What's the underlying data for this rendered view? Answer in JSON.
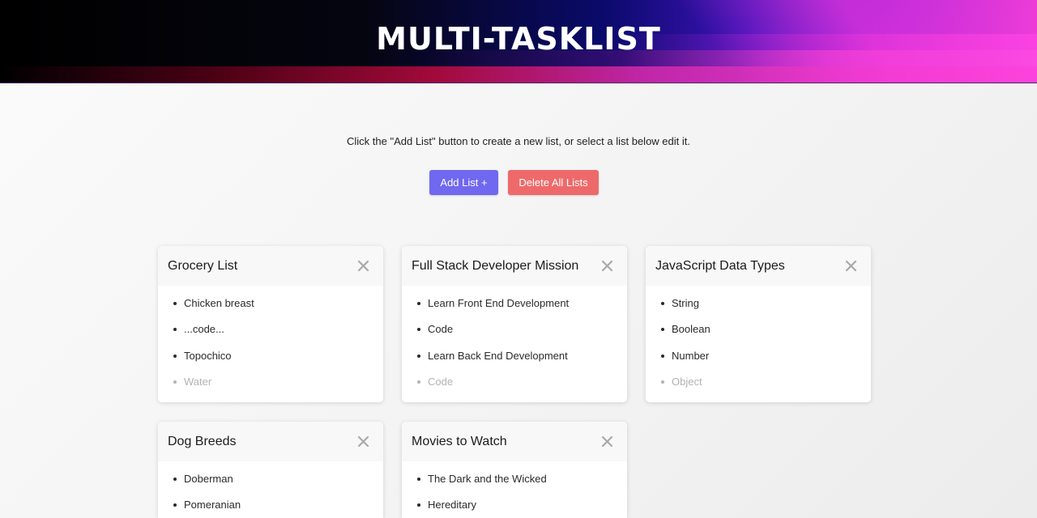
{
  "header": {
    "title": "MULTI-TASKLIST"
  },
  "instructions": "Click the \"Add List\" button to create a new list, or select a list below edit it.",
  "buttons": {
    "add": "Add List +",
    "delete_all": "Delete All Lists"
  },
  "colors": {
    "add_button": "#7068ef",
    "delete_button": "#ee6a6a"
  },
  "lists": [
    {
      "title": "Grocery List",
      "items": [
        "Chicken breast",
        "...code...",
        "Topochico",
        "Water"
      ]
    },
    {
      "title": "Full Stack Developer Mission",
      "items": [
        "Learn Front End Development",
        "Code",
        "Learn Back End Development",
        "Code"
      ]
    },
    {
      "title": "JavaScript Data Types",
      "items": [
        "String",
        "Boolean",
        "Number",
        "Object"
      ]
    },
    {
      "title": "Dog Breeds",
      "items": [
        "Doberman",
        "Pomeranian"
      ]
    },
    {
      "title": "Movies to Watch",
      "items": [
        "The Dark and the Wicked",
        "Hereditary"
      ]
    }
  ]
}
